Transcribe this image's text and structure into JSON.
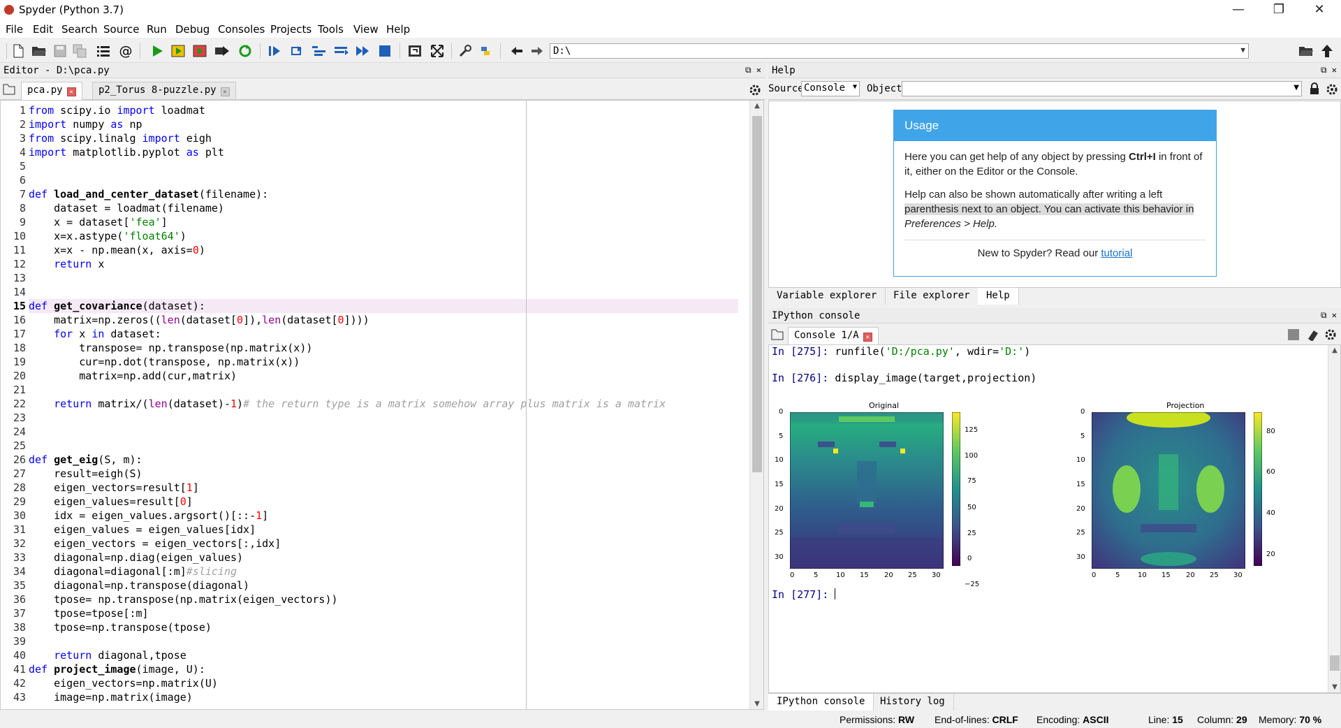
{
  "window": {
    "title": "Spyder (Python 3.7)",
    "minimize": "—",
    "maximize": "❐",
    "close": "✕"
  },
  "menu": [
    "File",
    "Edit",
    "Search",
    "Source",
    "Run",
    "Debug",
    "Consoles",
    "Projects",
    "Tools",
    "View",
    "Help"
  ],
  "toolbar": {
    "path": "D:\\"
  },
  "editor": {
    "header": "Editor - D:\\pca.py",
    "tabs": [
      "pca.py",
      "p2_Torus 8-puzzle.py"
    ],
    "current_line": 15
  },
  "help": {
    "header": "Help",
    "source_label": "Source",
    "source_value": "Console",
    "object_label": "Object",
    "usage_title": "Usage",
    "p1a": "Here you can get help of any object by pressing ",
    "p1b": "Ctrl+I",
    "p1c": " in front of it, either on the Editor or the Console.",
    "p2a": "Help can also be shown automatically after writing a left ",
    "p2b": "parenthesis next to an object. You can activate this behavior in",
    "p2c": "Preferences > Help.",
    "foot_a": "New to Spyder? Read our ",
    "foot_link": "tutorial",
    "tabs": [
      "Variable explorer",
      "File explorer",
      "Help"
    ]
  },
  "console": {
    "header": "IPython console",
    "tab": "Console 1/A",
    "in275_prompt": "In [275]: ",
    "in275_a": "runfile(",
    "in275_s1": "'D:/pca.py'",
    "in275_b": ", wdir=",
    "in275_s2": "'D:'",
    "in275_c": ")",
    "in276_prompt": "In [276]: ",
    "in276_code": "display_image(target,projection)",
    "in277_prompt": "In [277]: ",
    "bottom_tabs": [
      "IPython console",
      "History log"
    ]
  },
  "plots": {
    "left_title": "Original",
    "right_title": "Projection",
    "y_ticks": [
      "0",
      "5",
      "10",
      "15",
      "20",
      "25",
      "30"
    ],
    "x_ticks": [
      "0",
      "5",
      "10",
      "15",
      "20",
      "25",
      "30"
    ],
    "left_cbar": [
      "125",
      "100",
      "75",
      "50",
      "25",
      "0",
      "−25"
    ],
    "right_cbar": [
      "80",
      "60",
      "40",
      "20"
    ]
  },
  "status": {
    "perm_label": "Permissions:",
    "perm": "RW",
    "eol_label": "End-of-lines:",
    "eol": "CRLF",
    "enc_label": "Encoding:",
    "enc": "ASCII",
    "line_label": "Line:",
    "line": "15",
    "col_label": "Column:",
    "col": "29",
    "mem_label": "Memory:",
    "mem": "70 %"
  },
  "icons": {
    "new": "new-file-icon",
    "open": "open-folder-icon",
    "save": "save-icon",
    "save_all": "save-all-icon",
    "outline": "outline-icon",
    "at": "at-icon",
    "run": "run-icon",
    "run_cell": "run-cell-icon",
    "run_cell_adv": "run-cell-advance-icon",
    "run_sel": "run-selection-icon",
    "rerun": "rerun-icon",
    "debug": "debug-icon",
    "stop": "stop-icon",
    "maximize": "maximize-pane-icon",
    "fullscreen": "fullscreen-icon",
    "prefs": "wrench-icon",
    "python": "python-path-icon",
    "back": "back-arrow-icon",
    "forward": "forward-arrow-icon",
    "browse": "browse-folder-icon",
    "parent": "parent-dir-icon"
  }
}
